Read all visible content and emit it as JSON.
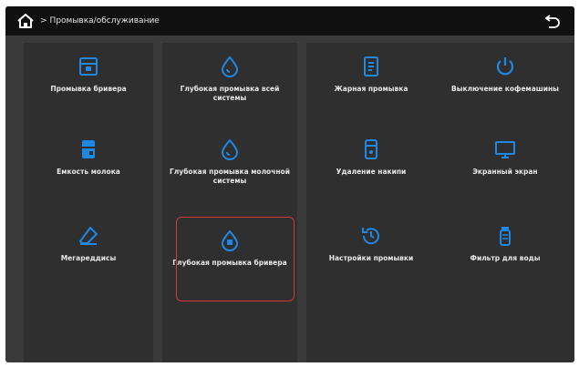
{
  "header": {
    "breadcrumb_sep": ">",
    "breadcrumb_title": "Промывка/обслуживание"
  },
  "tiles": [
    {
      "label": "Промывка бривера",
      "icon": "box-icon"
    },
    {
      "label": "Глубокая промывка всей системы",
      "icon": "water-drop-icon"
    },
    {
      "label": "Жарная промывка",
      "icon": "document-icon"
    },
    {
      "label": "Выключение кофемашины",
      "icon": "power-icon"
    },
    {
      "label": "Емкость молока",
      "icon": "milk-container-icon"
    },
    {
      "label": "Глубокая промывка молочной системы",
      "icon": "water-drop-icon"
    },
    {
      "label": "Удаление накипи",
      "icon": "descale-icon"
    },
    {
      "label": "Экранный экран",
      "icon": "monitor-icon"
    },
    {
      "label": "Мегареддисы",
      "icon": "eraser-icon"
    },
    {
      "label": "Глубокая промывка бривера",
      "icon": "brewer-icon"
    },
    {
      "label": "Настройки промывки",
      "icon": "history-icon"
    },
    {
      "label": "Фильтр для воды",
      "icon": "water-filter-icon"
    }
  ],
  "selected_tile": "Глубокая промывка бривера",
  "colors": {
    "accent": "#1e88e5",
    "selection": "#d23a3a",
    "background": "#3a3a3a"
  }
}
